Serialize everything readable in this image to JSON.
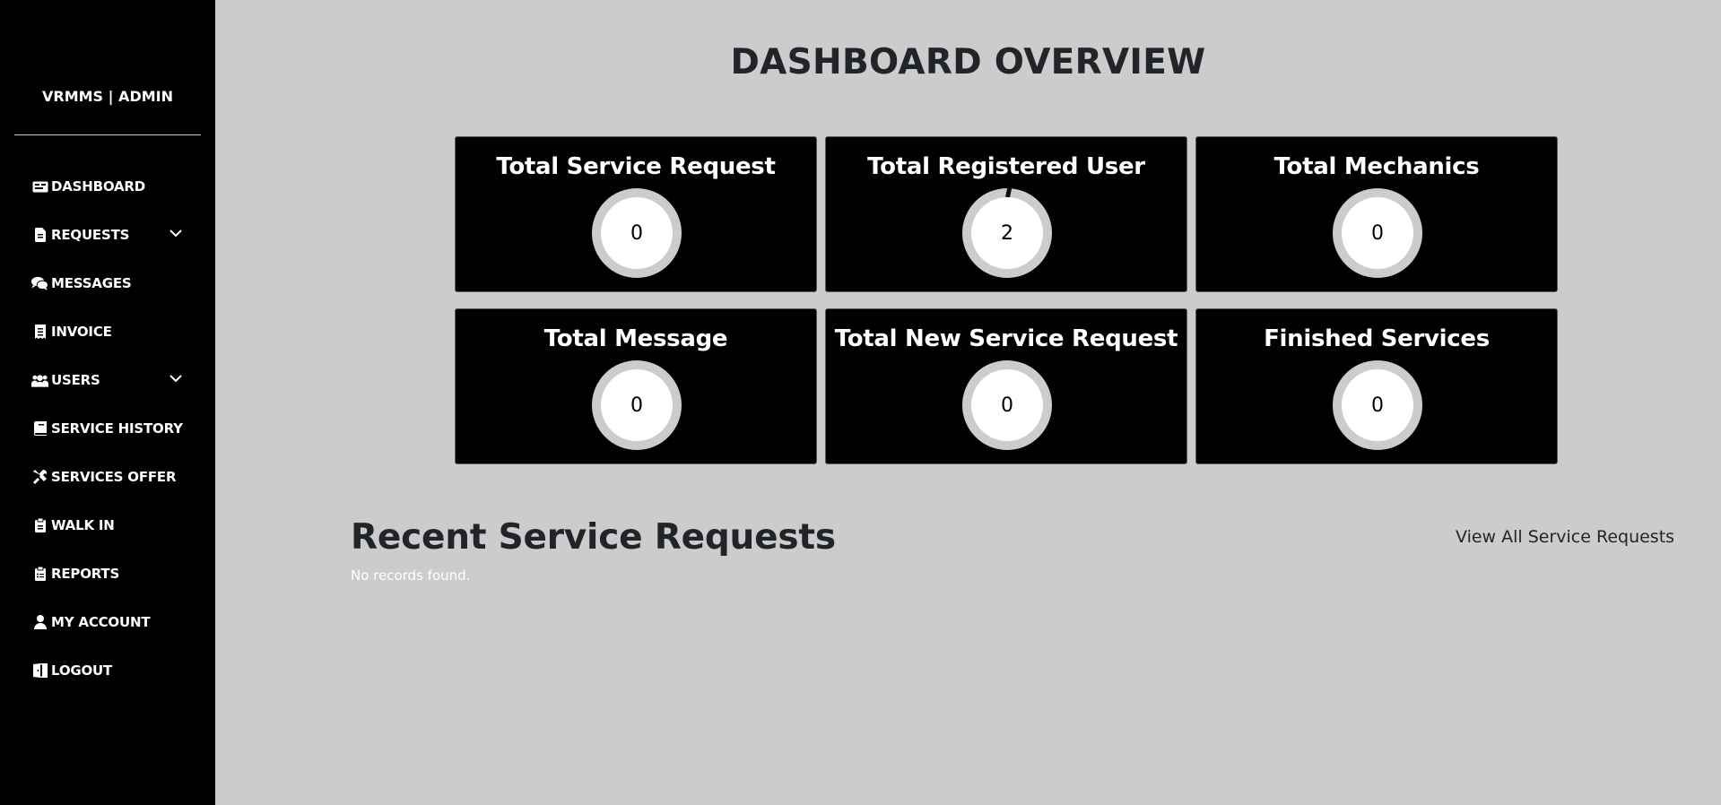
{
  "sidebar": {
    "brand": "VRMMS | ADMIN",
    "items": [
      {
        "label": "DASHBOARD",
        "icon": "dashboard-icon",
        "has_dropdown": false
      },
      {
        "label": "REQUESTS",
        "icon": "file-icon",
        "has_dropdown": true
      },
      {
        "label": "MESSAGES",
        "icon": "comments-icon",
        "has_dropdown": false
      },
      {
        "label": "INVOICE",
        "icon": "receipt-icon",
        "has_dropdown": false
      },
      {
        "label": "USERS",
        "icon": "users-icon",
        "has_dropdown": true
      },
      {
        "label": "SERVICE HISTORY",
        "icon": "book-icon",
        "has_dropdown": false
      },
      {
        "label": "SERVICES OFFER",
        "icon": "tools-icon",
        "has_dropdown": false
      },
      {
        "label": "WALK IN",
        "icon": "clipboard-icon",
        "has_dropdown": false
      },
      {
        "label": "REPORTS",
        "icon": "clipboard-list-icon",
        "has_dropdown": false
      },
      {
        "label": "MY ACCOUNT",
        "icon": "user-icon",
        "has_dropdown": false
      },
      {
        "label": "LOGOUT",
        "icon": "door-open-icon",
        "has_dropdown": false
      }
    ]
  },
  "main": {
    "title": "DASHBOARD OVERVIEW",
    "cards": [
      {
        "title": "Total Service Request",
        "value": "0"
      },
      {
        "title": "Total Registered User",
        "value": "2"
      },
      {
        "title": "Total Mechanics",
        "value": "0"
      },
      {
        "title": "Total Message",
        "value": "0"
      },
      {
        "title": "Total New Service Request",
        "value": "0"
      },
      {
        "title": "Finished Services",
        "value": "0"
      }
    ],
    "recent": {
      "title": "Recent Service Requests",
      "view_all": "View All Service Requests",
      "empty_text": "No records found."
    }
  },
  "colors": {
    "sidebar_bg": "#000000",
    "page_bg": "#cccccc",
    "card_bg": "#000000",
    "ring_track": "#cccccc",
    "heading_text": "#212529"
  }
}
